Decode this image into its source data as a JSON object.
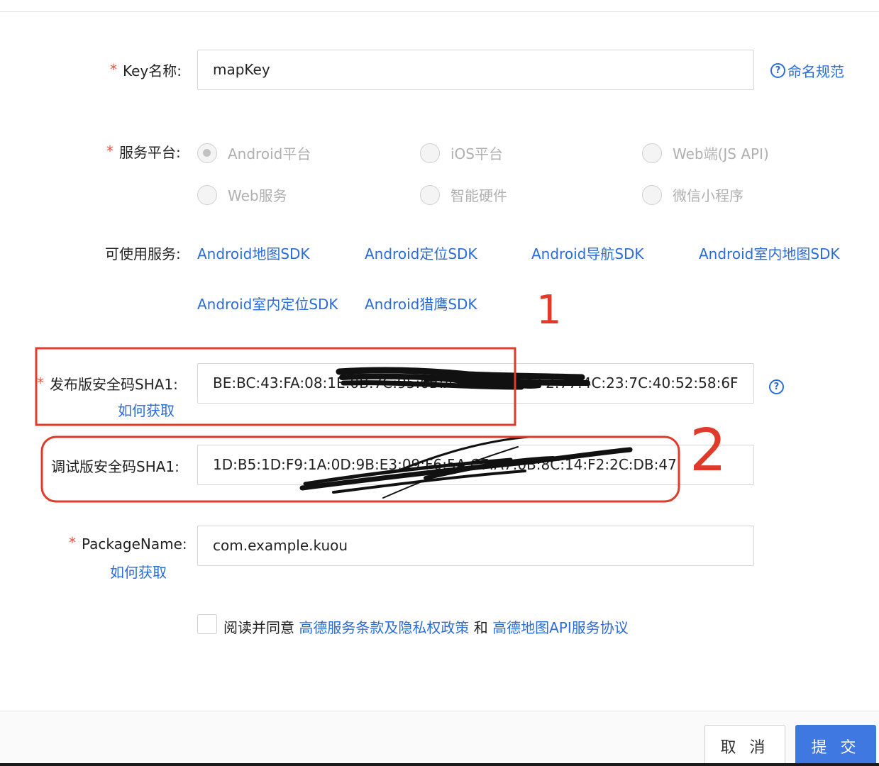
{
  "form": {
    "key_name": {
      "label": "Key名称:",
      "value": "mapKey",
      "help_link": "命名规范"
    },
    "platform": {
      "label": "服务平台:",
      "options": [
        {
          "label": "Android平台",
          "checked": true
        },
        {
          "label": "iOS平台",
          "checked": false
        },
        {
          "label": "Web端(JS API)",
          "checked": false
        },
        {
          "label": "Web服务",
          "checked": false
        },
        {
          "label": "智能硬件",
          "checked": false
        },
        {
          "label": "微信小程序",
          "checked": false
        }
      ]
    },
    "services": {
      "label": "可使用服务:",
      "items": [
        "Android地图SDK",
        "Android定位SDK",
        "Android导航SDK",
        "Android室内地图SDK",
        "Android室内定位SDK",
        "Android猎鹰SDK"
      ]
    },
    "release_sha1": {
      "label": "发布版安全码SHA1:",
      "value": "BE:BC:43:FA:08:1E:0B:7C:95:6B:A1:3D:9E:E4:F2:77:4C:23:7C:40:52:58:6F",
      "how_to": "如何获取"
    },
    "debug_sha1": {
      "label": "调试版安全码SHA1:",
      "value": "1D:B5:1D:F9:1A:0D:9B:E3:09:F6:5A:C7:A7:0B:8C:14:F2:2C:DB:47"
    },
    "package_name": {
      "label": "PackageName:",
      "value": "com.example.kuou",
      "how_to": "如何获取"
    },
    "agreement": {
      "prefix": "阅读并同意",
      "link1": "高德服务条款及隐私权政策",
      "joiner": "和",
      "link2": "高德地图API服务协议"
    }
  },
  "footer": {
    "cancel_label": "取 消",
    "submit_label": "提 交"
  },
  "annotations": {
    "mark1": "1",
    "mark2": "2"
  },
  "colors": {
    "accent": "#2a6cd8",
    "required": "#e8553f",
    "annotation": "#e03a2a",
    "submit": "#3f78e0"
  }
}
